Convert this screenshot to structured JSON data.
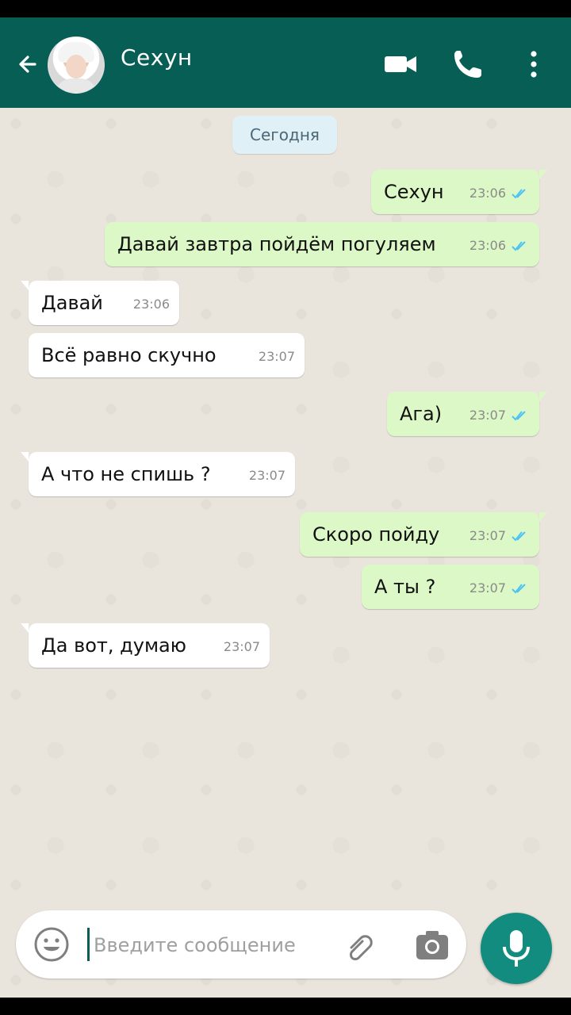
{
  "header": {
    "contact_name": "Сехун",
    "background": "#075e54",
    "icons": [
      "back-arrow-icon",
      "video-call-icon",
      "phone-icon",
      "more-vert-icon"
    ]
  },
  "date_chip": "Сегодня",
  "messages": [
    {
      "direction": "out",
      "text": "Сехун",
      "time": "23:06",
      "status": "read"
    },
    {
      "direction": "out",
      "text": "Давай завтра пойдём погуляем",
      "time": "23:06",
      "status": "read"
    },
    {
      "direction": "in",
      "text": "Давай",
      "time": "23:06"
    },
    {
      "direction": "in",
      "text": "Всё равно скучно",
      "time": "23:07"
    },
    {
      "direction": "out",
      "text": "Ага)",
      "time": "23:07",
      "status": "read"
    },
    {
      "direction": "in",
      "text": "А что не спишь ?",
      "time": "23:07"
    },
    {
      "direction": "out",
      "text": "Скоро пойду",
      "time": "23:07",
      "status": "read"
    },
    {
      "direction": "out",
      "text": "А ты ?",
      "time": "23:07",
      "status": "read"
    },
    {
      "direction": "in",
      "text": "Да вот, думаю",
      "time": "23:07"
    }
  ],
  "composer": {
    "placeholder": "Введите сообщение",
    "icons": [
      "emoji-icon",
      "paperclip-icon",
      "camera-icon",
      "mic-icon"
    ]
  },
  "colors": {
    "outgoing_bubble": "#dcf8c6",
    "incoming_bubble": "#ffffff",
    "read_check": "#4fc3f7",
    "mic_button": "#128c7e"
  }
}
